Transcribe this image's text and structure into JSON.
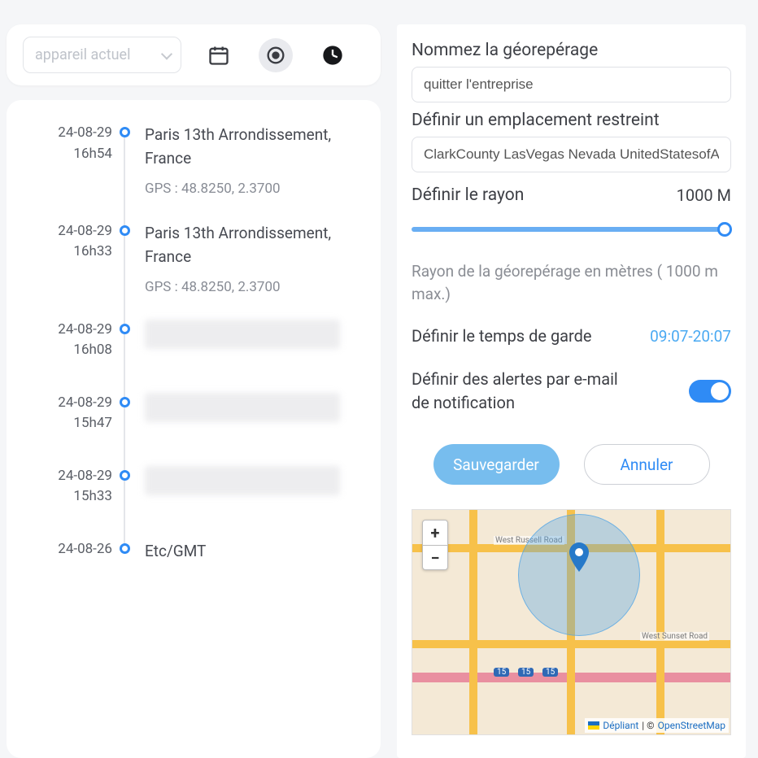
{
  "toolbar": {
    "device_placeholder": "appareil actuel"
  },
  "entries": [
    {
      "date": "24-08-29",
      "time": "16h54",
      "location": "Paris 13th Arrondissement, France",
      "gps": "GPS :  48.8250, 2.3700"
    },
    {
      "date": "24-08-29",
      "time": "16h33",
      "location": "Paris 13th Arrondissement, France",
      "gps": "GPS :  48.8250, 2.3700"
    },
    {
      "date": "24-08-29",
      "time": "16h08",
      "location": "",
      "gps": ""
    },
    {
      "date": "24-08-29",
      "time": "15h47",
      "location": "",
      "gps": ""
    },
    {
      "date": "24-08-29",
      "time": "15h33",
      "location": "",
      "gps": ""
    },
    {
      "date": "24-08-26",
      "time": "",
      "location": "Etc/GMT",
      "gps": ""
    }
  ],
  "form": {
    "name_label": "Nommez la géorepérage",
    "name_value": "quitter l'entreprise",
    "location_label": "Définir un emplacement restreint",
    "location_value": "ClarkCounty LasVegas Nevada UnitedStatesofAmerica(the)",
    "radius_label": "Définir le rayon",
    "radius_value": "1000 M",
    "hint": "Rayon de la géorepérage en mètres ( 1000 m max.)",
    "guard_label": "Définir le temps de garde",
    "guard_time": "09:07-20:07",
    "alert_label": "Définir des alertes par e-mail de notification",
    "save_label": "Sauvegarder",
    "cancel_label": "Annuler"
  },
  "map": {
    "road1": "West Russell Road",
    "road2": "West Sunset Road",
    "hwy_badge": "15",
    "zoom_in": "+",
    "zoom_out": "−",
    "attrib_leaflet": "Dépliant",
    "attrib_sep": " | © ",
    "attrib_osm": "OpenStreetMap"
  }
}
